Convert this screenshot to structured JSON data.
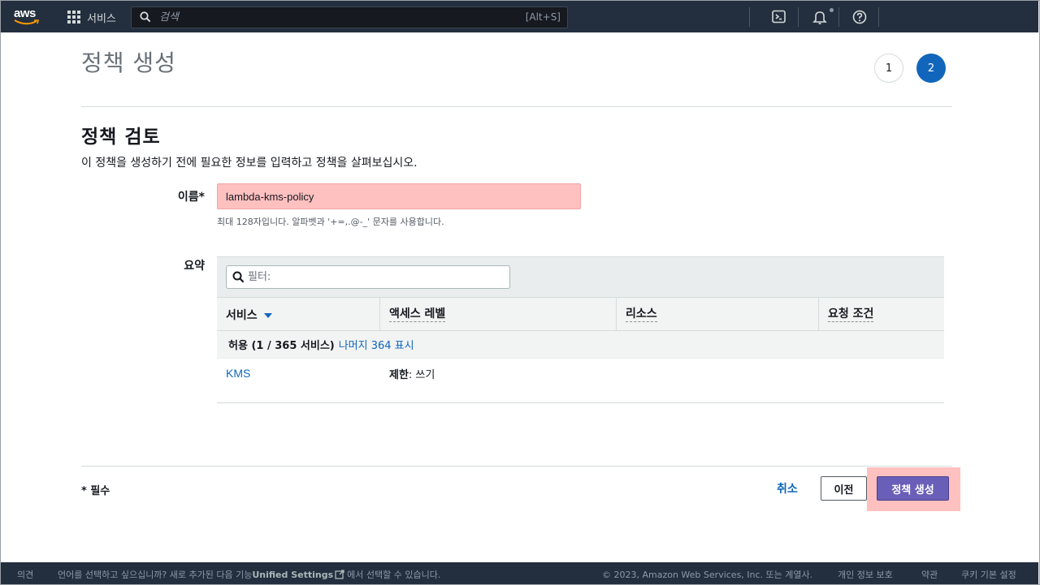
{
  "topnav": {
    "logo_text": "aws",
    "services_label": "서비스",
    "search_placeholder": "검색",
    "search_shortcut": "[Alt+S]",
    "icons": [
      "cloudshell-icon",
      "bell-icon",
      "help-icon"
    ]
  },
  "header": {
    "title": "정책 생성",
    "steps": [
      "1",
      "2"
    ],
    "active_step": "2"
  },
  "review": {
    "title": "정책 검토",
    "description": "이 정책을 생성하기 전에 필요한 정보를 입력하고 정책을 살펴보십시오.",
    "name_label": "이름*",
    "name_value": "lambda-kms-policy",
    "name_hint": "최대 128자입니다. 알파벳과 '+=,.@-_' 문자를 사용합니다.",
    "summary_label": "요약"
  },
  "summary": {
    "filter_placeholder": "필터:",
    "columns": [
      "서비스",
      "액세스 레벨",
      "리소스",
      "요청 조건"
    ],
    "group_label": "허용 (1 / 365 서비스)",
    "group_link": "나머지 364 표시",
    "rows": [
      {
        "service": "KMS",
        "access_prefix": "제한",
        "access_rest": ": 쓰기"
      }
    ]
  },
  "footer_actions": {
    "required_note": "* 필수",
    "cancel": "취소",
    "previous": "이전",
    "create": "정책 생성"
  },
  "footer": {
    "feedback": "의견",
    "language_text": "언어를 선택하고 싶으십니까? 새로 추가된 다음 기능",
    "unified_settings": "Unified Settings",
    "language_suffix": "에서 선택할 수 있습니다.",
    "copyright": "© 2023, Amazon Web Services, Inc. 또는 계열사.",
    "privacy": "개인 정보 보호",
    "terms": "약관",
    "cookies": "쿠키 기본 설정"
  },
  "colors": {
    "nav_bg": "#232f3e",
    "link": "#1166bb",
    "primary_button": "#6a5fb8",
    "highlight": "#ffc0c0"
  }
}
